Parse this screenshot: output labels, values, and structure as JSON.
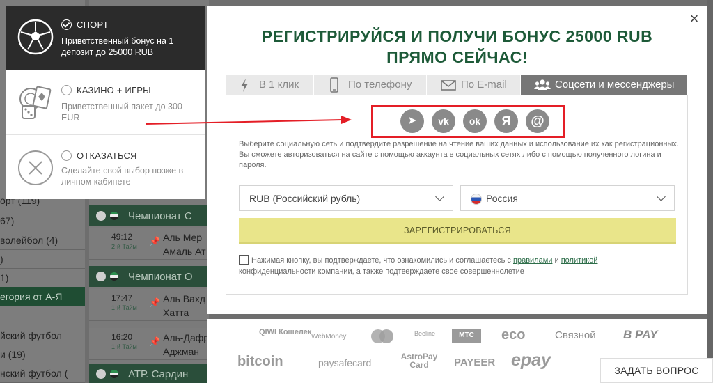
{
  "background": {
    "left_items": [
      {
        "label": "орт (119)"
      },
      {
        "label": "67)"
      },
      {
        "label": "волейбол (4)"
      },
      {
        "label": ")"
      },
      {
        "label": "1)"
      },
      {
        "category": "егория от А-Я"
      },
      {
        "label": "йский футбол"
      },
      {
        "label": "и (19)"
      },
      {
        "label": "нский футбол ("
      }
    ],
    "events": [
      {
        "type": "header",
        "label": "Чемпионат С"
      },
      {
        "type": "match",
        "time": "49:12",
        "half": "2-й Тайм",
        "team1": "Аль Мер",
        "team2": "Амаль Ат"
      },
      {
        "type": "header",
        "label": "Чемпионат О"
      },
      {
        "type": "match",
        "time": "17:47",
        "half": "1-й Тайм",
        "team1": "Аль Вахд",
        "team2": "Хатта"
      },
      {
        "type": "match",
        "time": "16:20",
        "half": "1-й Тайм",
        "team1": "Аль-Дафр",
        "team2": "Аджман"
      },
      {
        "type": "header",
        "label": "АТР. Сардин"
      }
    ]
  },
  "bonus_panel": {
    "options": [
      {
        "title": "СПОРТ",
        "desc": "Приветственный бонус на 1 депозит до 25000 RUB",
        "checked": true,
        "icon": "soccer-ball-icon"
      },
      {
        "title": "КАЗИНО + ИГРЫ",
        "desc": "Приветственный пакет до 300 EUR",
        "checked": false,
        "icon": "casino-cards-dice-icon"
      },
      {
        "title": "ОТКАЗАТЬСЯ",
        "desc": "Сделайте свой выбор позже в личном кабинете",
        "checked": false,
        "icon": "decline-x-icon"
      }
    ]
  },
  "modal": {
    "close_glyph": "×",
    "title_line1": "РЕГИСТРИРУЙСЯ И ПОЛУЧИ БОНУС 25000 RUB",
    "title_line2": "ПРЯМО СЕЙЧАС!",
    "tabs": [
      {
        "label": "В 1 клик",
        "icon": "lightning-icon",
        "active": false
      },
      {
        "label": "По телефону",
        "icon": "phone-icon",
        "active": false
      },
      {
        "label": "По E-mail",
        "icon": "envelope-icon",
        "active": false
      },
      {
        "label": "Соцсети и мессенджеры",
        "icon": "users-icon",
        "active": true
      }
    ],
    "socials": [
      {
        "name": "telegram-icon",
        "glyph": "➤"
      },
      {
        "name": "vk-icon",
        "glyph": "vk"
      },
      {
        "name": "odnoklassniki-icon",
        "glyph": "ok"
      },
      {
        "name": "yandex-icon",
        "glyph": "Я"
      },
      {
        "name": "mailru-icon",
        "glyph": "@"
      }
    ],
    "info_line1": "Выберите социальную сеть и подтвердите разрешение на чтение ваших данных и использование их как регистрационных.",
    "info_line2": "Вы сможете авторизоваться на сайте с помощью аккаунта в социальных сетях либо с помощью полученного логина и пароля.",
    "currency_value": "RUB (Российский рубль)",
    "country_value": "Россия",
    "register_label": "ЗАРЕГИСТРИРОВАТЬСЯ",
    "agree_prefix": "Нажимая кнопку, вы подтверждаете, что ознакомились и соглашаетесь с",
    "agree_rules": "правилами",
    "agree_and": "и",
    "agree_policy": "политикой",
    "agree_suffix": "конфиденциальности компании, а также подтверждаете свое совершеннолетие"
  },
  "payments": [
    {
      "label": "QIWI Кошелек"
    },
    {
      "label": "WebMoney"
    },
    {
      "label": "MasterCard"
    },
    {
      "label": "Beeline"
    },
    {
      "label": "МТС"
    },
    {
      "label": "eco"
    },
    {
      "label": "Связной"
    },
    {
      "label": "B PAY"
    },
    {
      "label": "bitcoin"
    },
    {
      "label": "paysafecard"
    },
    {
      "label": "AstroPay Card"
    },
    {
      "label": "PAYEER"
    },
    {
      "label": "epay"
    }
  ],
  "ask_question": "ЗАДАТЬ ВОПРОС",
  "colors": {
    "title_green": "#1d5a38",
    "highlight_red": "#e41e26",
    "register_yellow": "#e9e58a",
    "active_tab": "#777777"
  }
}
